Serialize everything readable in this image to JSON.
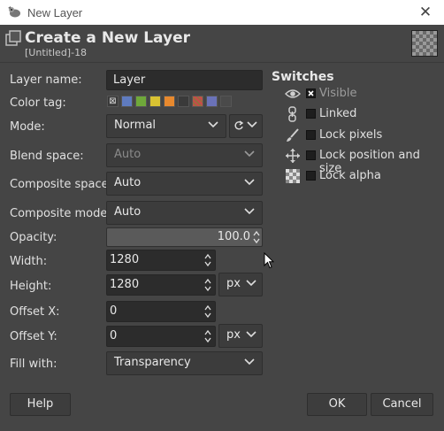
{
  "window": {
    "title": "New Layer"
  },
  "header": {
    "title": "Create a New Layer",
    "subtitle": "[Untitled]-18"
  },
  "form": {
    "layer_name_label": "Layer name:",
    "layer_name_value": "Layer",
    "color_tag_label": "Color tag:",
    "color_tags": [
      "#e0e0e0",
      "#5f7bbf",
      "#6fa83a",
      "#d9c232",
      "#e8892e",
      "#c94a4a",
      "#9a6b3f",
      "#6a72b8",
      "#7a7a7a"
    ],
    "mode_label": "Mode:",
    "mode_value": "Normal",
    "blend_space_label": "Blend space:",
    "blend_space_value": "Auto",
    "composite_space_label": "Composite space:",
    "composite_space_value": "Auto",
    "composite_mode_label": "Composite mode:",
    "composite_mode_value": "Auto",
    "opacity_label": "Opacity:",
    "opacity_value": "100.0",
    "width_label": "Width:",
    "width_value": "1280",
    "height_label": "Height:",
    "height_value": "1280",
    "size_unit": "px",
    "offset_x_label": "Offset X:",
    "offset_x_value": "0",
    "offset_y_label": "Offset Y:",
    "offset_y_value": "0",
    "offset_unit": "px",
    "fill_label": "Fill with:",
    "fill_value": "Transparency"
  },
  "switches": {
    "title": "Switches",
    "items": [
      {
        "label": "Visible",
        "checked": true,
        "icon": "eye-icon"
      },
      {
        "label": "Linked",
        "checked": false,
        "icon": "chain-icon"
      },
      {
        "label": "Lock pixels",
        "checked": false,
        "icon": "brush-icon"
      },
      {
        "label": "Lock position and size",
        "checked": false,
        "icon": "move-icon"
      },
      {
        "label": "Lock alpha",
        "checked": false,
        "icon": "checkerboard-icon"
      }
    ]
  },
  "buttons": {
    "help": "Help",
    "ok": "OK",
    "cancel": "Cancel"
  }
}
